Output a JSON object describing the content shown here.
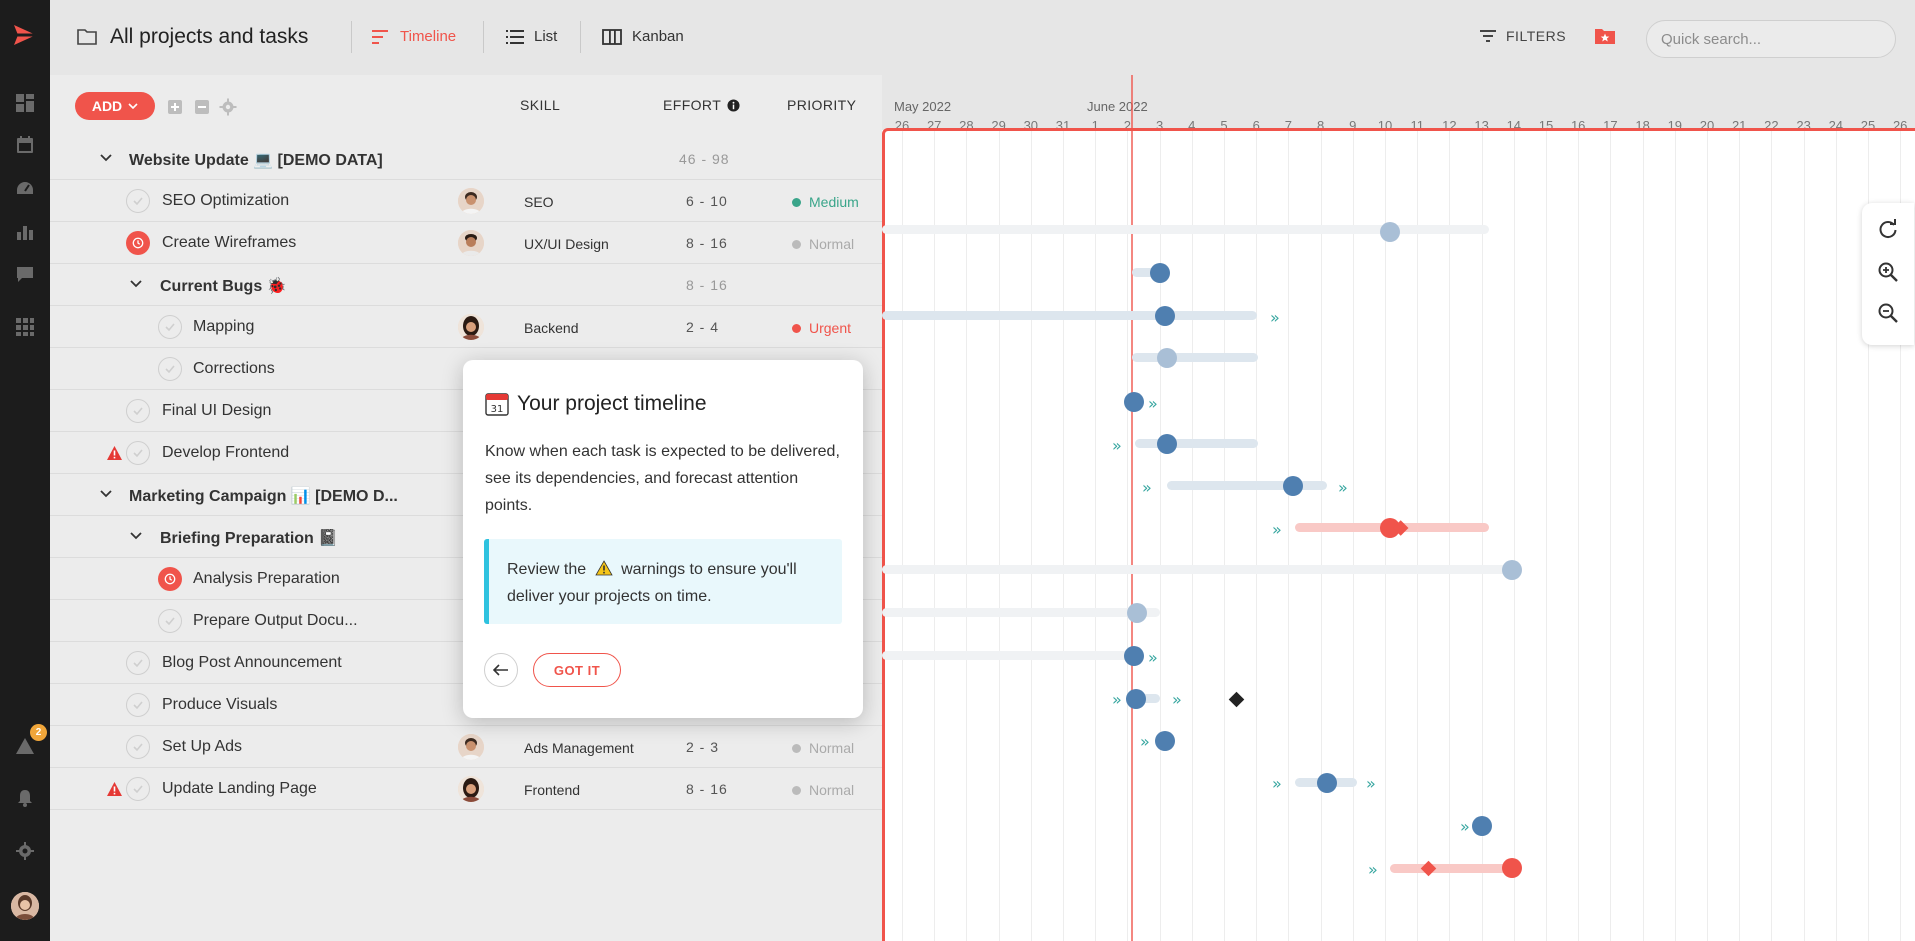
{
  "header": {
    "title": "All projects and tasks",
    "tabs": [
      {
        "label": "Timeline",
        "active": true
      },
      {
        "label": "List"
      },
      {
        "label": "Kanban"
      }
    ],
    "filters_label": "FILTERS",
    "search_placeholder": "Quick search..."
  },
  "rail": {
    "alert_count": "2"
  },
  "table": {
    "add_label": "ADD",
    "columns": {
      "skill": "SKILL",
      "effort": "EFFORT",
      "priority": "PRIORITY"
    },
    "rows": [
      {
        "name": "Website Update 💻 [DEMO DATA]",
        "effort": "46 - 98"
      },
      {
        "name": "SEO Optimization",
        "skill": "SEO",
        "effort": "6 - 10",
        "priority": "Medium"
      },
      {
        "name": "Create Wireframes",
        "skill": "UX/UI Design",
        "effort": "8 - 16",
        "priority": "Normal"
      },
      {
        "name": "Current Bugs 🐞",
        "effort": "8 - 16"
      },
      {
        "name": "Mapping",
        "skill": "Backend",
        "effort": "2 - 4",
        "priority": "Urgent"
      },
      {
        "name": "Corrections"
      },
      {
        "name": "Final UI Design"
      },
      {
        "name": "Develop Frontend"
      },
      {
        "name": "Marketing Campaign 📊 [DEMO D..."
      },
      {
        "name": "Briefing Preparation 📓"
      },
      {
        "name": "Analysis Preparation"
      },
      {
        "name": "Prepare Output Docu..."
      },
      {
        "name": "Blog Post Announcement"
      },
      {
        "name": "Produce Visuals"
      },
      {
        "name": "Set Up Ads",
        "skill": "Ads Management",
        "effort": "2 - 3",
        "priority": "Normal"
      },
      {
        "name": "Update Landing Page",
        "skill": "Frontend",
        "effort": "8 - 16",
        "priority": "Normal"
      }
    ]
  },
  "timeline": {
    "months": [
      "May 2022",
      "June 2022"
    ],
    "days": [
      "26",
      "27",
      "28",
      "29",
      "30",
      "31",
      "1",
      "2",
      "3",
      "4",
      "5",
      "6",
      "7",
      "8",
      "9",
      "10",
      "11",
      "12",
      "13",
      "14",
      "15",
      "16",
      "17",
      "18",
      "19",
      "20",
      "21",
      "22",
      "23",
      "24",
      "25",
      "26"
    ]
  },
  "popup": {
    "title": "Your project timeline",
    "body": "Know when each task is expected to be delivered, see its dependencies, and forecast attention points.",
    "note_before": "Review the",
    "note_after": "warnings to ensure you'll deliver your projects on time.",
    "got_it": "GOT IT"
  },
  "colors": {
    "accent": "#f0544b",
    "bar_blue": "#4f7fb0",
    "info_border": "#2ec2df"
  }
}
